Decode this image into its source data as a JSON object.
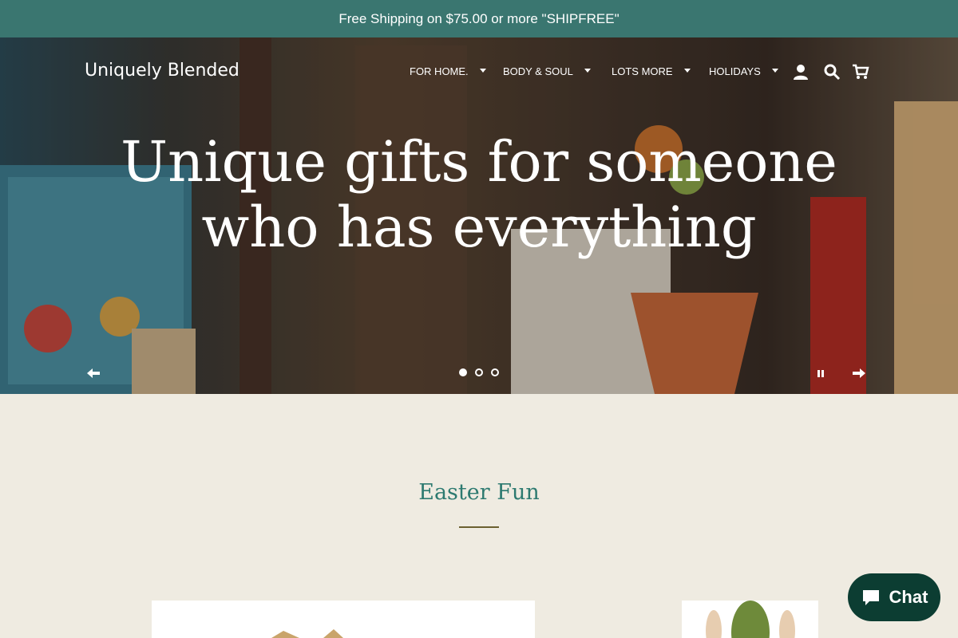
{
  "announcement": {
    "text": "Free Shipping on $75.00 or more \"SHIPFREE\""
  },
  "header": {
    "logo": "Uniquely Blended",
    "nav": [
      {
        "label": "FOR HOME."
      },
      {
        "label": "BODY & SOUL"
      },
      {
        "label": "LOTS MORE"
      },
      {
        "label": "HOLIDAYS"
      }
    ],
    "icons": [
      "account-icon",
      "search-icon",
      "cart-icon"
    ]
  },
  "hero": {
    "headline_line1": "Unique gifts for someone",
    "headline_line2": "who has everything",
    "slides": {
      "count": 3,
      "active": 1
    },
    "controls": [
      "previous-arrow-icon",
      "pause-icon",
      "next-arrow-icon"
    ]
  },
  "section": {
    "title": "Easter Fun"
  },
  "chat": {
    "label": "Chat",
    "icon": "chat-bubble-icon"
  },
  "colors": {
    "announcement_bg": "#3a7670",
    "accent": "#2d7a70",
    "chat_bg": "#0c3d32",
    "page_bg": "#efebe1"
  }
}
